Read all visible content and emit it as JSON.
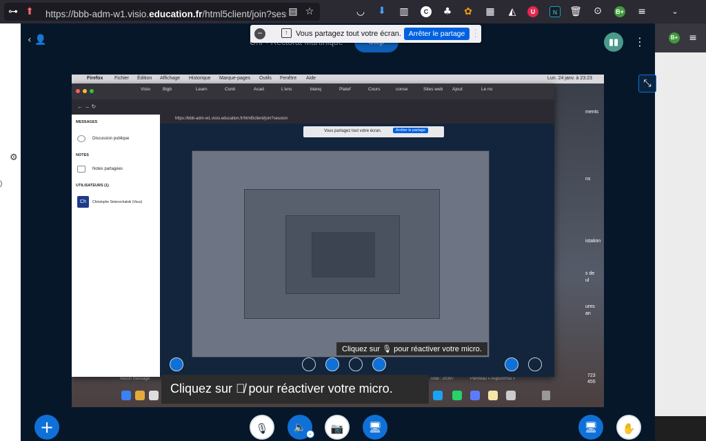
{
  "browser": {
    "url_prefix": "https://bbb-adm-w1.visio.",
    "url_domain": "education.fr",
    "url_suffix": "/html5client/join?sessionT",
    "extensions": [
      {
        "name": "c-icon",
        "label": "C",
        "color": "#ffffff"
      },
      {
        "name": "u-icon",
        "label": "U",
        "color": "#e22850"
      },
      {
        "name": "n-icon",
        "label": "N",
        "color": "#16a4b8"
      },
      {
        "name": "b-icon",
        "label": "B+",
        "color": "#3f9b3b"
      }
    ]
  },
  "share_banner": {
    "message": "Vous partagez tout votre écran.",
    "stop_label": "Arrêter le partage"
  },
  "header": {
    "title": "Onr - Rectorat Martinique",
    "record_label": "Stop"
  },
  "shared_screen": {
    "menubar": {
      "app": "Firefox",
      "menus": [
        "Fichier",
        "Édition",
        "Affichage",
        "Historique",
        "Marque-pages",
        "Outils",
        "Fenêtre",
        "Aide"
      ],
      "clock": "Lun. 24 janv. à 23:23"
    },
    "tabs": [
      "Visio",
      "Bigb",
      "Learn",
      "Conti",
      "Acad",
      "L'ens",
      "blanq",
      "Platef",
      "Cours",
      "conse",
      "Sites web",
      "Ajout",
      "Le no"
    ],
    "inner_url": "https://bbb-adm-w1.visio.education.fr/html5client/join?session",
    "sidebar": {
      "messages_heading": "MESSAGES",
      "public_chat": "Discussion publique",
      "notes_heading": "NOTES",
      "shared_notes": "Notes partagées",
      "users_heading": "UTILISATEURS (1)",
      "user_name": "Christophe Smierzchalski (Vous)",
      "user_initials": "Ch"
    },
    "inner_banner_message": "Vous partagez tout votre écran.",
    "inner_banner_stop": "Arrêter le partage",
    "inner_toast": "Cliquez sur 🎙 pour réactiver votre micro.",
    "status_left": "Aucun message",
    "status_total": "Total : 20397",
    "status_panel": "Panneau « Aujourd'hui »",
    "desktop_numbers": [
      "723",
      "455"
    ],
    "desktop_labels": [
      "ments",
      "ns",
      "istation",
      "s de",
      "ul",
      "ures",
      "an"
    ]
  },
  "toast": {
    "text": "Cliquez sur 🎙̸ pour réactiver votre micro."
  },
  "actions": {
    "plus_icon": "+",
    "mic_icon": "🎙",
    "audio_icon": "🔈",
    "camera_icon": "📷",
    "screen_icon": "🖥",
    "presentation_icon": "🖥",
    "hand_icon": "✋"
  }
}
